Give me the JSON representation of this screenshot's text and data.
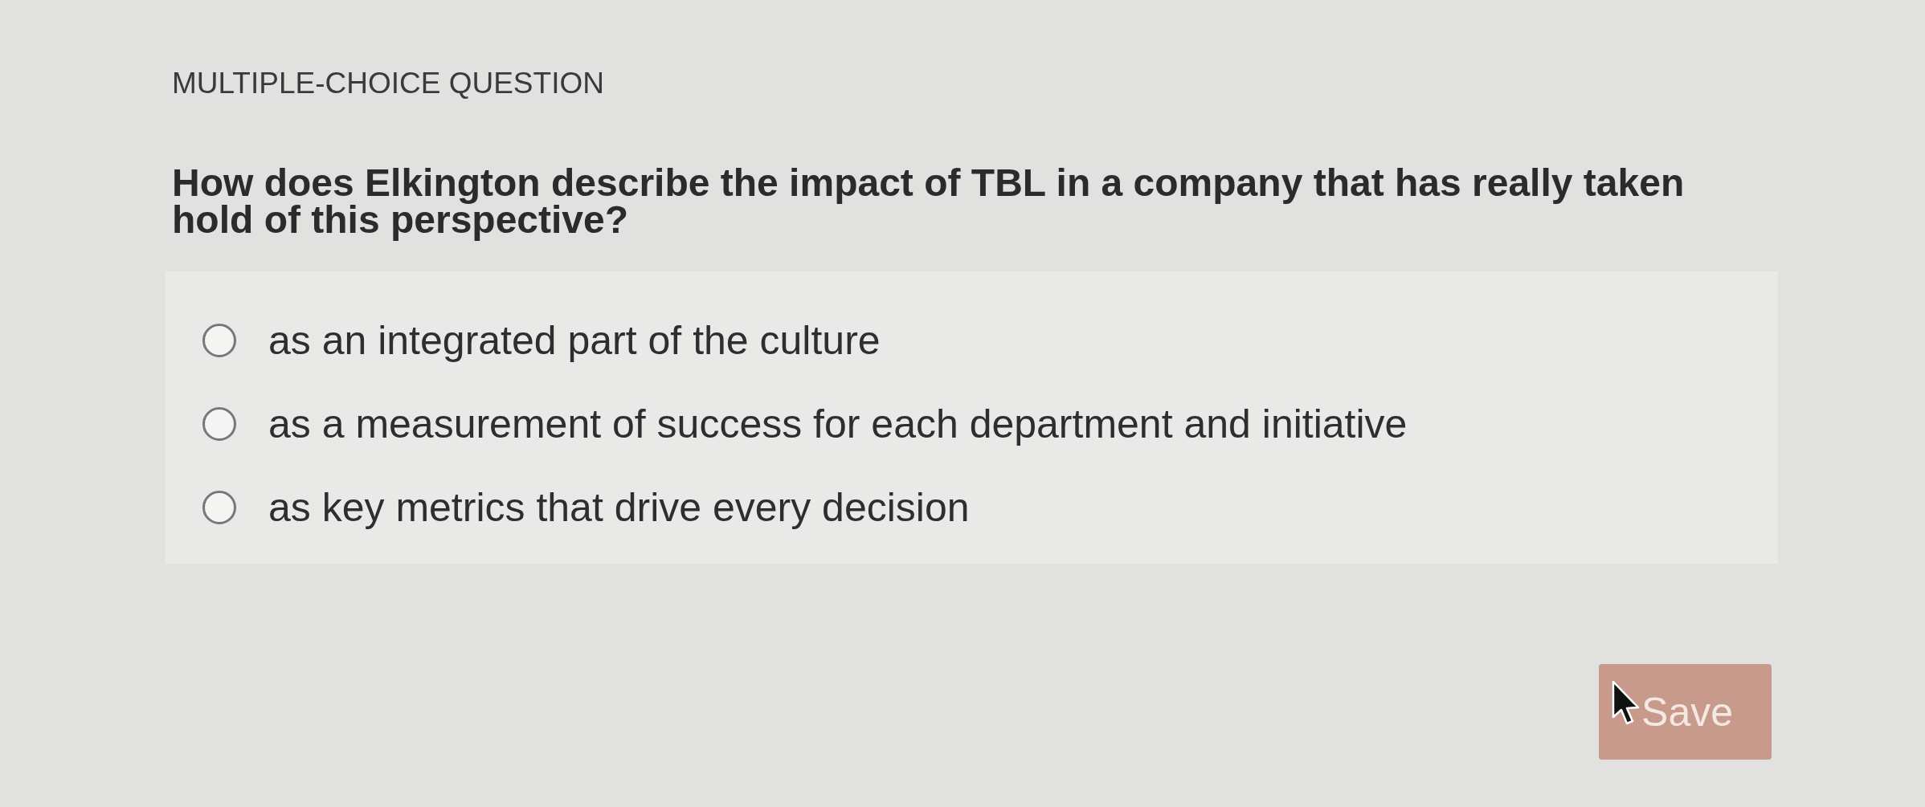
{
  "heading": "MULTIPLE-CHOICE QUESTION",
  "question": "How does Elkington describe the impact of TBL in a company that has really taken hold of this perspective?",
  "options": [
    {
      "label": "as an integrated part of the culture",
      "selected": false
    },
    {
      "label": "as a measurement of success for each department and initiative",
      "selected": false
    },
    {
      "label": "as key metrics that drive every decision",
      "selected": false
    }
  ],
  "save_button": {
    "label": "Save"
  }
}
